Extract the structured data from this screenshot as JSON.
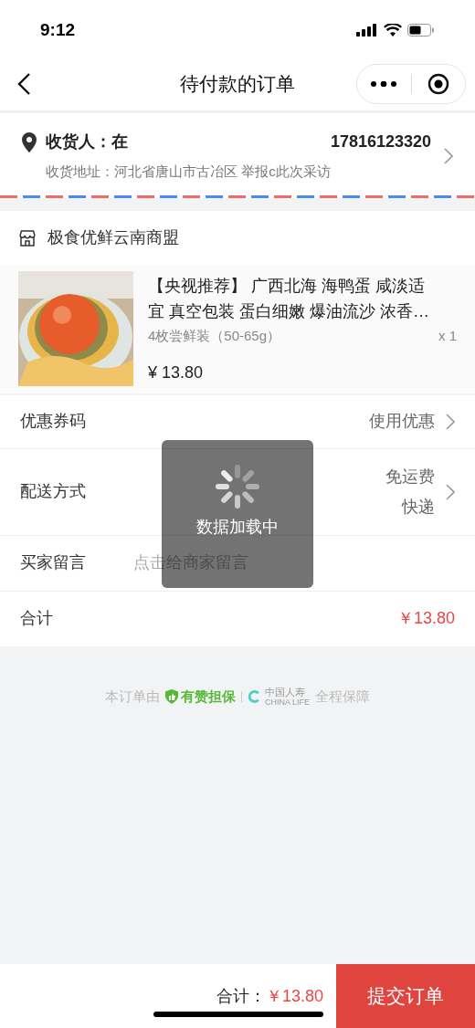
{
  "status_bar": {
    "time": "9:12"
  },
  "nav": {
    "title": "待付款的订单"
  },
  "address": {
    "recipient": "收货人：在",
    "phone": "17816123320",
    "address": "收货地址：河北省唐山市古冶区 举报c此次采访"
  },
  "store": {
    "name": "极食优鲜云南商盟"
  },
  "product": {
    "title": "【央视推荐】 广西北海 海鸭蛋 咸淡适宜 真空包装 蛋白细嫩 爆油流沙 浓香…",
    "variant": "4枚尝鲜装（50-65g）",
    "quantity": "x 1",
    "price": "¥ 13.80"
  },
  "rows": [
    {
      "kind": "link",
      "label": "优惠券码",
      "values": [
        "使用优惠"
      ]
    },
    {
      "kind": "link",
      "label": "配送方式",
      "values": [
        "免运费",
        "快递"
      ]
    },
    {
      "kind": "input",
      "label": "买家留言",
      "placeholder": "点击给商家留言"
    },
    {
      "kind": "total",
      "label": "合计",
      "values": [
        "￥13.80"
      ]
    }
  ],
  "guarantee": {
    "prefix": "本订单由",
    "brand": "有赞担保",
    "partner_logo": [
      "中国人寿",
      "CHINA LIFE"
    ],
    "suffix": "全程保障"
  },
  "toast": {
    "text": "数据加载中"
  },
  "footer": {
    "total_label": "合计：",
    "total": "￥13.80",
    "submit": "提交订单"
  }
}
